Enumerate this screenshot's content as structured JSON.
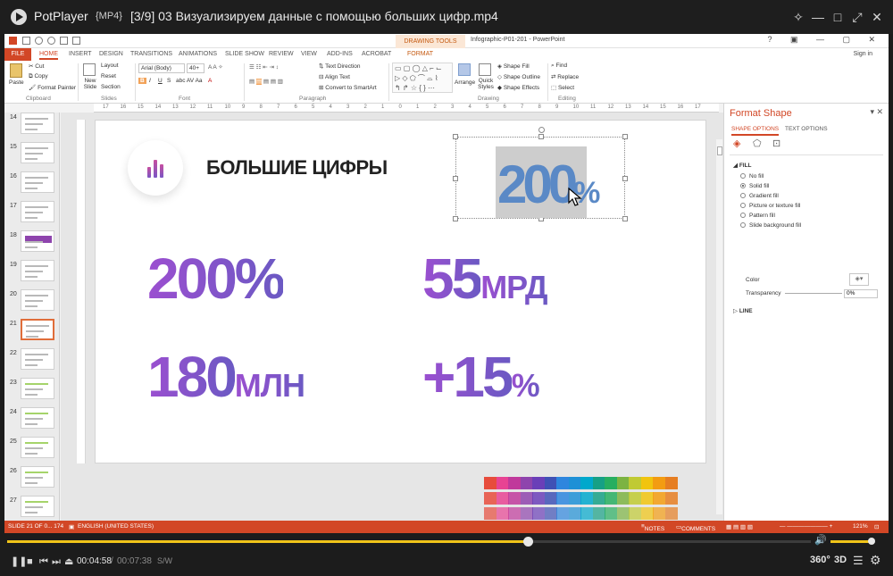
{
  "player": {
    "app_name": "PotPlayer",
    "format": "{MP4}",
    "file_title": "[3/9] 03 Визуализируем данные с помощью больших цифр.mp4",
    "time_current": "00:04:58",
    "time_separator": "/",
    "time_total": "00:07:38",
    "subtitle_toggle": "S/W",
    "label_360": "360°",
    "label_3d": "3D",
    "seek_progress": 0.648,
    "volume_level": 0.92,
    "accent": "#f0c419"
  },
  "ppt": {
    "drawing_tools_label": "DRAWING TOOLS",
    "doc_title": "Infographic-P01-201 - PowerPoint",
    "tabs": [
      "FILE",
      "HOME",
      "INSERT",
      "DESIGN",
      "TRANSITIONS",
      "ANIMATIONS",
      "SLIDE SHOW",
      "REVIEW",
      "VIEW",
      "ADD-INS",
      "ACROBAT",
      "FORMAT"
    ],
    "sign_in": "Sign in",
    "ribbon": {
      "paste": "Paste",
      "cut": "Cut",
      "copy": "Copy",
      "format_painter": "Format Painter",
      "clipboard": "Clipboard",
      "new_slide": "New Slide",
      "layout": "Layout",
      "reset": "Reset",
      "section": "Section",
      "slides": "Slides",
      "font_name": "Arial (Body)",
      "font_size": "40+",
      "font": "Font",
      "text_direction": "Text Direction",
      "align_text": "Align Text",
      "convert_smartart": "Convert to SmartArt",
      "paragraph": "Paragraph",
      "arrange": "Arrange",
      "quick_styles": "Quick Styles",
      "shape_fill": "Shape Fill",
      "shape_outline": "Shape Outline",
      "shape_effects": "Shape Effects",
      "drawing": "Drawing",
      "find": "Find",
      "replace": "Replace",
      "select": "Select",
      "editing": "Editing"
    },
    "ruler_marks": [
      "17",
      "16",
      "15",
      "14",
      "13",
      "12",
      "11",
      "10",
      "9",
      "8",
      "7",
      "6",
      "5",
      "4",
      "3",
      "2",
      "1",
      "0",
      "1",
      "2",
      "3",
      "4",
      "5",
      "6",
      "7",
      "8",
      "9",
      "10",
      "11",
      "12",
      "13",
      "14",
      "15",
      "16",
      "17"
    ],
    "thumbnails": [
      {
        "num": "14",
        "selected": false
      },
      {
        "num": "15",
        "selected": false
      },
      {
        "num": "16",
        "selected": false
      },
      {
        "num": "17",
        "selected": false
      },
      {
        "num": "18",
        "selected": false
      },
      {
        "num": "19",
        "selected": false
      },
      {
        "num": "20",
        "selected": false
      },
      {
        "num": "21",
        "selected": true
      },
      {
        "num": "22",
        "selected": false
      },
      {
        "num": "23",
        "selected": false
      },
      {
        "num": "24",
        "selected": false
      },
      {
        "num": "25",
        "selected": false
      },
      {
        "num": "26",
        "selected": false
      },
      {
        "num": "27",
        "selected": false
      }
    ],
    "slide": {
      "title": "БОЛЬШИЕ ЦИФРЫ",
      "stat1_num": "200%",
      "stat2_num": "55",
      "stat2_unit": "МРД",
      "stat3_num": "180",
      "stat3_unit": "МЛН",
      "stat4_num": "+15",
      "stat4_unit": "%",
      "selected_num": "200",
      "selected_pct": "%"
    },
    "format_pane": {
      "title": "Format Shape",
      "tab_shape": "SHAPE OPTIONS",
      "tab_text": "TEXT OPTIONS",
      "fill_header": "FILL",
      "options": [
        "No fill",
        "Solid fill",
        "Gradient fill",
        "Picture or texture fill",
        "Pattern fill",
        "Slide background fill"
      ],
      "selected_option": "Solid fill",
      "color_label": "Color",
      "transparency_label": "Transparency",
      "transparency_value": "0%",
      "line_header": "LINE"
    },
    "status": {
      "slide_info": "SLIDE 21 OF 0... 174",
      "language": "ENGLISH (UNITED STATES)",
      "notes": "NOTES",
      "comments": "COMMENTS",
      "zoom": "121%"
    },
    "accent": "#d24726"
  },
  "palette": [
    "#e74c3c",
    "#e84393",
    "#c0399b",
    "#8e44ad",
    "#6a3fb8",
    "#3f51b5",
    "#2e86de",
    "#1e90d6",
    "#00a8cc",
    "#16a085",
    "#27ae60",
    "#7cb342",
    "#c0ca33",
    "#f1c40f",
    "#f39c12",
    "#e67e22"
  ]
}
